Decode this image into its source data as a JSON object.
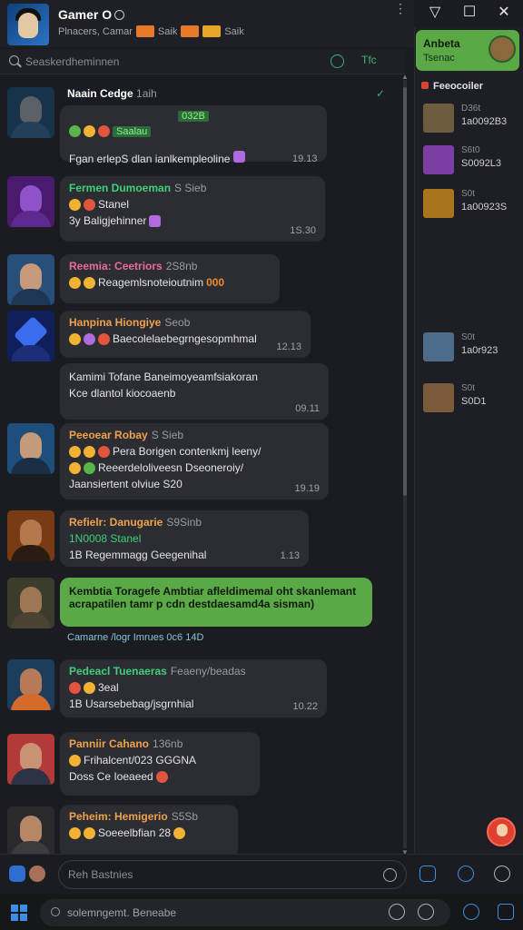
{
  "header": {
    "title": "Gamer O",
    "subtitle": "Plnacers, Camar",
    "tag1_label": "Saik",
    "tag2_label": "Saik",
    "kebab": "⋮"
  },
  "window": {
    "minimize": "▽",
    "maximize": "☐",
    "close": "✕"
  },
  "search": {
    "placeholder": "Seaskerdheminnen",
    "tag_label": "Tfc"
  },
  "messages": [
    {
      "name": "Naain Cedge",
      "meta": "1aih",
      "name_color": "#ffffff",
      "chip": "032B",
      "line1": "Saalau",
      "line2": "Fgan erlepS dlan ianlkempleoline",
      "time": "19.13",
      "av_bg": "#16334a",
      "av_hd": "#5b5f66",
      "av_sh": "#23405a"
    },
    {
      "name": "Fermen Dumoeman",
      "meta": "S Sieb",
      "name_color": "#3fd07a",
      "line1": "Stanel",
      "line2": "3y Baligjehinner",
      "time": "1S.30",
      "av_bg": "#4a1a6e",
      "av_hd": "#8f53c9",
      "av_sh": "#5f2a8f"
    },
    {
      "name": "Reemia: Ceetriors",
      "meta": "2S8nb",
      "name_color": "#ea6aa0",
      "line1": "Reagemlsnoteioutnim",
      "line2": "000",
      "time": "",
      "av_bg": "#284e7a",
      "av_hd": "#c79a7b",
      "av_sh": "#1e3553"
    },
    {
      "name": "Hanpina Hiongiye",
      "meta": "Seob",
      "name_color": "#f0a24a",
      "line1": "Baecolelaebegrngesopmhmal",
      "time": "12.13",
      "av_bg": "#0f1f5a",
      "av_hd": "#3b6cf0",
      "av_sh": "#1c2e78"
    },
    {
      "name": "",
      "meta": "",
      "name_color": "#ffffff",
      "line1": "Kamimi Tofane Baneimoyeamfsiakoran",
      "line2": "Kce dlantol kiocoaenb",
      "time": "09.11",
      "av_bg": "",
      "av_hd": "",
      "av_sh": ""
    },
    {
      "name": "Peeoear Robay",
      "meta": "S Sieb",
      "name_color": "#f0a24a",
      "line1": "Pera Borigen contenkmj leeny/",
      "line2": "Reeerdeloliveesn Dseoneroiy/",
      "line3": "Jaansiertent olviue S20",
      "time": "19.19",
      "av_bg": "#1e4f7c",
      "av_hd": "#c59a78",
      "av_sh": "#1a2e44"
    },
    {
      "name": "Refielr: Danugarie",
      "meta": "S9Sinb",
      "name_color": "#f0a24a",
      "line1": "1N0008 Stanel",
      "line2": "1B Regemmagg Geegenihal",
      "time": "1.13",
      "av_bg": "#7a3a14",
      "av_hd": "#b5784e",
      "av_sh": "#2b1c12"
    },
    {
      "green": "Kembtia Toragefe Ambtiar afleldimemal oht skanlemant acrapatilen tamr p cdn destdaesamd4a sisman)",
      "caption": "Camarne /logr Imrues 0c6 14D",
      "av_bg": "#3c3c2c",
      "av_hd": "#9e7654",
      "av_sh": "#4a4334"
    },
    {
      "name": "Pedeacl Tuenaeras",
      "meta": "Feaeny/beadas",
      "name_color": "#3fd07a",
      "line1": "3eal",
      "line2": "1B Usarsebebag/jsgrnhial",
      "time": "10.22",
      "av_bg": "#1d3d5c",
      "av_hd": "#b67a56",
      "av_sh": "#d46b2b"
    },
    {
      "name": "Panniir Cahano",
      "meta": "136nb",
      "name_color": "#f0a24a",
      "line1": "Frihalcent/023 GGGNA",
      "line2": "Doss Ce Ioeaeed",
      "time": "",
      "av_bg": "#b43a3a",
      "av_hd": "#c99273",
      "av_sh": "#2e3344"
    },
    {
      "name": "Peheim: Hemigerio",
      "meta": "S5Sb",
      "name_color": "#f0a24a",
      "line1": "Soeeelbfian 28",
      "time": "",
      "av_bg": "#2a2a2e",
      "av_hd": "#b68765",
      "av_sh": "#3b3b40"
    }
  ],
  "right_panel": {
    "card_title": "Anbeta",
    "card_sub": "Tsenac",
    "section": "Feeocoiler",
    "items": [
      {
        "a": "D36t",
        "b": "1a0092B3",
        "color": "#6e5a3c"
      },
      {
        "a": "S6t0",
        "b": "S0092L3",
        "color": "#7b3fa4"
      },
      {
        "a": "S0t",
        "b": "1a00923S",
        "color": "#a8741d"
      },
      {
        "a": "S0t",
        "b": "1a0r923",
        "color": "#4d6b8a"
      },
      {
        "a": "S0t",
        "b": "S0D1",
        "color": "#7a5a3a"
      }
    ]
  },
  "composer": {
    "placeholder": "Reh Bastnies"
  },
  "taskbar": {
    "search": "solemngemt. Beneabe"
  }
}
